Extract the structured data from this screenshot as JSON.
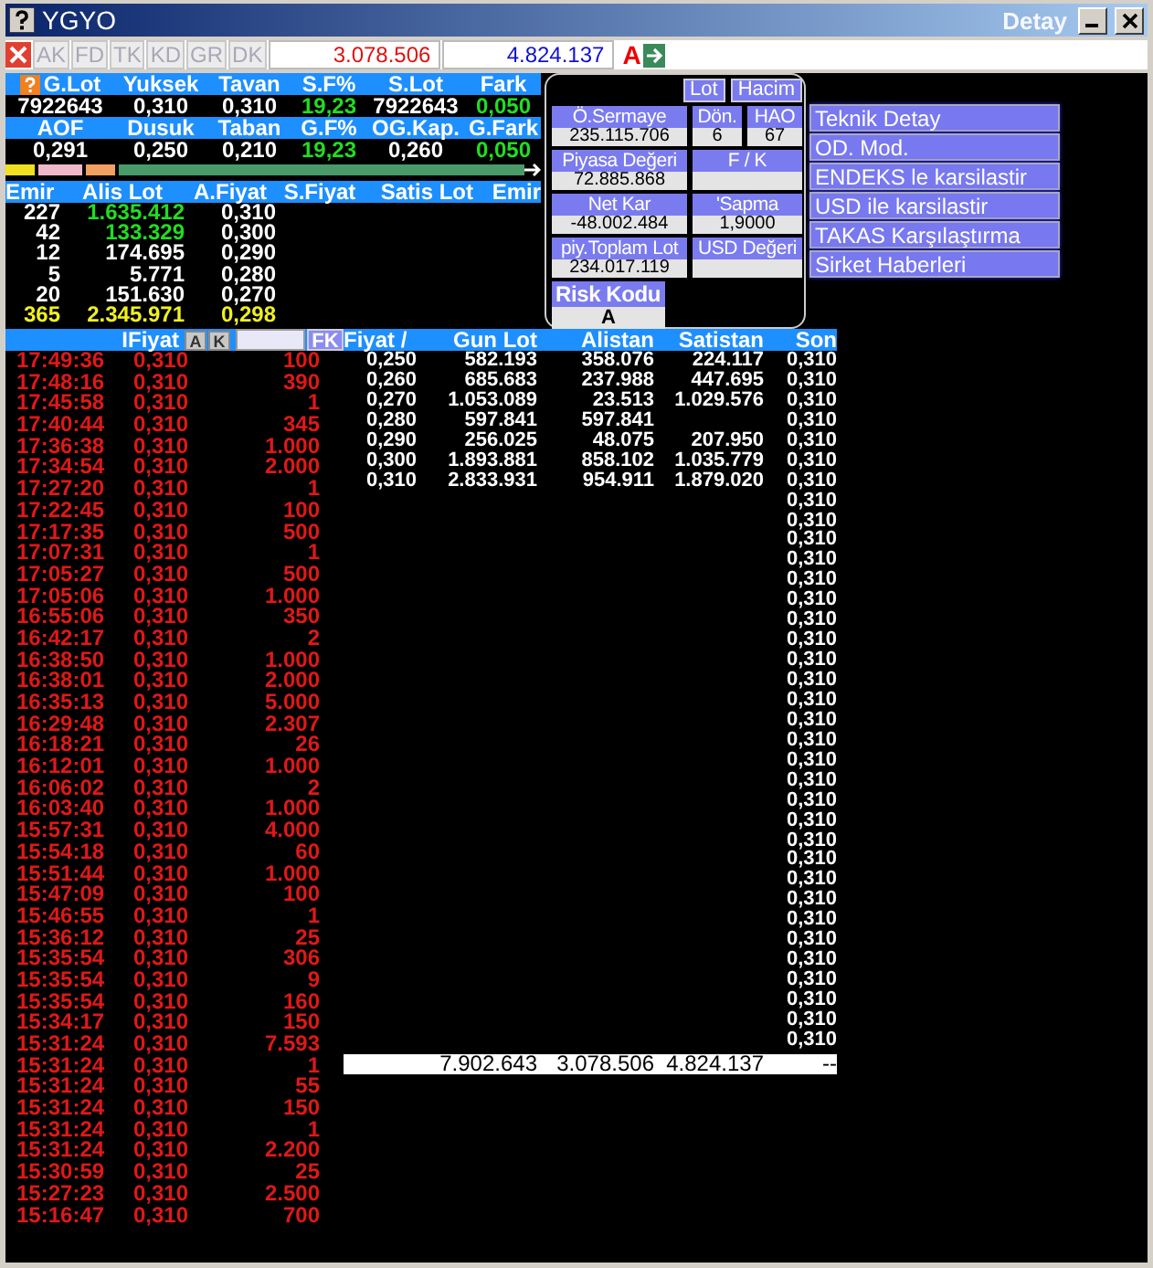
{
  "window": {
    "title": "YGYO",
    "subtitle": "Detay"
  },
  "toolbar": {
    "tabs": [
      "AK",
      "FD",
      "TK",
      "KD",
      "GR",
      "DK"
    ],
    "buy_total": "3.078.506",
    "sell_total": "4.824.137",
    "flag": "A"
  },
  "stats_rows": [
    {
      "headers": [
        "G.Lot",
        "Yuksek",
        "Tavan",
        "S.F%",
        "S.Lot",
        "Fark"
      ],
      "values": [
        {
          "text": "7922643",
          "up": false
        },
        {
          "text": "0,310",
          "up": false
        },
        {
          "text": "0,310",
          "up": false
        },
        {
          "text": "19,23",
          "up": true
        },
        {
          "text": "7922643",
          "up": false
        },
        {
          "text": "0,050",
          "up": true
        }
      ]
    },
    {
      "headers": [
        "AOF",
        "Dusuk",
        "Taban",
        "G.F%",
        "OG.Kap.",
        "G.Fark"
      ],
      "values": [
        {
          "text": "0,291",
          "up": false
        },
        {
          "text": "0,250",
          "up": false
        },
        {
          "text": "0,210",
          "up": false
        },
        {
          "text": "19,23",
          "up": true
        },
        {
          "text": "0,260",
          "up": false
        },
        {
          "text": "0,050",
          "up": true
        }
      ]
    }
  ],
  "order_book": {
    "columns": [
      "Emir",
      "Alis Lot",
      "A.Fiyat",
      "S.Fiyat",
      "Satis Lot",
      "Emir"
    ],
    "rows": [
      {
        "kind": "order",
        "emir": "227",
        "lot": "1.635.412",
        "price": "0,310",
        "up": true
      },
      {
        "kind": "order",
        "emir": "42",
        "lot": "133.329",
        "price": "0,300",
        "up": true
      },
      {
        "kind": "order",
        "emir": "12",
        "lot": "174.695",
        "price": "0,290",
        "up": false
      },
      {
        "kind": "order",
        "emir": "5",
        "lot": "5.771",
        "price": "0,280",
        "up": false
      },
      {
        "kind": "order",
        "emir": "20",
        "lot": "151.630",
        "price": "0,270",
        "up": false
      },
      {
        "kind": "total",
        "emir": "365",
        "lot": "2.345.971",
        "price": "0,298",
        "up": false
      }
    ]
  },
  "summary_panel": {
    "buttons": [
      "Lot",
      "Hacim"
    ],
    "fields": [
      {
        "label": "Ö.Sermaye",
        "value": "235.115.706"
      },
      {
        "label": "Dön.",
        "value": "6"
      },
      {
        "label": "HAO",
        "value": "67"
      },
      {
        "label": "Piyasa Değeri",
        "value": "72.885.868"
      },
      {
        "label": "F / K"
      },
      {
        "label": "Net Kar",
        "value": "-48.002.484"
      },
      {
        "label": "'Sapma",
        "value": "1,9000"
      },
      {
        "label": "piy.Toplam Lot",
        "value": "234.017.119"
      },
      {
        "label": "USD Değeri"
      },
      {
        "label": "Risk Kodu",
        "value": "A"
      }
    ]
  },
  "actions": [
    "Teknik Detay",
    "OD. Mod.",
    "ENDEKS le karsilastir",
    "USD ile karsilastir",
    "TAKAS Karşılaştırma",
    "Sirket Haberleri"
  ],
  "trades": {
    "header": "IFiyat",
    "sort_buttons": [
      "A",
      "K"
    ],
    "filter_button": "FK",
    "rows": [
      {
        "time": "17:49:36",
        "price": "0,310",
        "lot": "100"
      },
      {
        "time": "17:48:16",
        "price": "0,310",
        "lot": "390"
      },
      {
        "time": "17:45:58",
        "price": "0,310",
        "lot": "1"
      },
      {
        "time": "17:40:44",
        "price": "0,310",
        "lot": "345"
      },
      {
        "time": "17:36:38",
        "price": "0,310",
        "lot": "1.000"
      },
      {
        "time": "17:34:54",
        "price": "0,310",
        "lot": "2.000"
      },
      {
        "time": "17:27:20",
        "price": "0,310",
        "lot": "1"
      },
      {
        "time": "17:22:45",
        "price": "0,310",
        "lot": "100"
      },
      {
        "time": "17:17:35",
        "price": "0,310",
        "lot": "500"
      },
      {
        "time": "17:07:31",
        "price": "0,310",
        "lot": "1"
      },
      {
        "time": "17:05:27",
        "price": "0,310",
        "lot": "500"
      },
      {
        "time": "17:05:06",
        "price": "0,310",
        "lot": "1.000"
      },
      {
        "time": "16:55:06",
        "price": "0,310",
        "lot": "350"
      },
      {
        "time": "16:42:17",
        "price": "0,310",
        "lot": "2"
      },
      {
        "time": "16:38:50",
        "price": "0,310",
        "lot": "1.000"
      },
      {
        "time": "16:38:01",
        "price": "0,310",
        "lot": "2.000"
      },
      {
        "time": "16:35:13",
        "price": "0,310",
        "lot": "5.000"
      },
      {
        "time": "16:29:48",
        "price": "0,310",
        "lot": "2.307"
      },
      {
        "time": "16:18:21",
        "price": "0,310",
        "lot": "26"
      },
      {
        "time": "16:12:01",
        "price": "0,310",
        "lot": "1.000"
      },
      {
        "time": "16:06:02",
        "price": "0,310",
        "lot": "2"
      },
      {
        "time": "16:03:40",
        "price": "0,310",
        "lot": "1.000"
      },
      {
        "time": "15:57:31",
        "price": "0,310",
        "lot": "4.000"
      },
      {
        "time": "15:54:18",
        "price": "0,310",
        "lot": "60"
      },
      {
        "time": "15:51:44",
        "price": "0,310",
        "lot": "1.000"
      },
      {
        "time": "15:47:09",
        "price": "0,310",
        "lot": "100"
      },
      {
        "time": "15:46:55",
        "price": "0,310",
        "lot": "1"
      },
      {
        "time": "15:36:12",
        "price": "0,310",
        "lot": "25"
      },
      {
        "time": "15:35:54",
        "price": "0,310",
        "lot": "306"
      },
      {
        "time": "15:35:54",
        "price": "0,310",
        "lot": "9"
      },
      {
        "time": "15:35:54",
        "price": "0,310",
        "lot": "160"
      },
      {
        "time": "15:34:17",
        "price": "0,310",
        "lot": "150"
      },
      {
        "time": "15:31:24",
        "price": "0,310",
        "lot": "7.593"
      },
      {
        "time": "15:31:24",
        "price": "0,310",
        "lot": "1"
      },
      {
        "time": "15:31:24",
        "price": "0,310",
        "lot": "55"
      },
      {
        "time": "15:31:24",
        "price": "0,310",
        "lot": "150"
      },
      {
        "time": "15:31:24",
        "price": "0,310",
        "lot": "1"
      },
      {
        "time": "15:31:24",
        "price": "0,310",
        "lot": "2.200"
      },
      {
        "time": "15:30:59",
        "price": "0,310",
        "lot": "25"
      },
      {
        "time": "15:27:23",
        "price": "0,310",
        "lot": "2.500"
      },
      {
        "time": "15:16:47",
        "price": "0,310",
        "lot": "700"
      }
    ]
  },
  "price_table": {
    "columns": [
      "Fiyat /",
      "Gun Lot",
      "Alistan",
      "Satistan",
      "Son"
    ],
    "rows": [
      {
        "fiyat": "0,250",
        "gun_lot": "582.193",
        "alistan": "358.076",
        "satistan": "224.117",
        "son": "0,310"
      },
      {
        "fiyat": "0,260",
        "gun_lot": "685.683",
        "alistan": "237.988",
        "satistan": "447.695",
        "son": "0,310"
      },
      {
        "fiyat": "0,270",
        "gun_lot": "1.053.089",
        "alistan": "23.513",
        "satistan": "1.029.576",
        "son": "0,310"
      },
      {
        "fiyat": "0,280",
        "gun_lot": "597.841",
        "alistan": "597.841",
        "son": "0,310"
      },
      {
        "fiyat": "0,290",
        "gun_lot": "256.025",
        "alistan": "48.075",
        "satistan": "207.950",
        "son": "0,310"
      },
      {
        "fiyat": "0,300",
        "gun_lot": "1.893.881",
        "alistan": "858.102",
        "satistan": "1.035.779",
        "son": "0,310"
      },
      {
        "fiyat": "0,310",
        "gun_lot": "2.833.931",
        "alistan": "954.911",
        "satistan": "1.879.020",
        "son": "0,310"
      },
      {
        "son": "0,310"
      },
      {
        "son": "0,310"
      },
      {
        "son": "0,310"
      },
      {
        "son": "0,310"
      },
      {
        "son": "0,310"
      },
      {
        "son": "0,310"
      },
      {
        "son": "0,310"
      },
      {
        "son": "0,310"
      },
      {
        "son": "0,310"
      },
      {
        "son": "0,310"
      },
      {
        "son": "0,310"
      },
      {
        "son": "0,310"
      },
      {
        "son": "0,310"
      },
      {
        "son": "0,310"
      },
      {
        "son": "0,310"
      },
      {
        "son": "0,310"
      },
      {
        "son": "0,310"
      },
      {
        "son": "0,310"
      },
      {
        "son": "0,310"
      },
      {
        "son": "0,310"
      },
      {
        "son": "0,310"
      },
      {
        "son": "0,310"
      },
      {
        "son": "0,310"
      },
      {
        "son": "0,310"
      },
      {
        "son": "0,310"
      },
      {
        "son": "0,310"
      },
      {
        "son": "0,310"
      },
      {
        "son": "0,310"
      }
    ],
    "totals": {
      "gun_lot": "7.902.643",
      "alistan": "3.078.506",
      "satistan": "4.824.137",
      "son": "--"
    }
  }
}
